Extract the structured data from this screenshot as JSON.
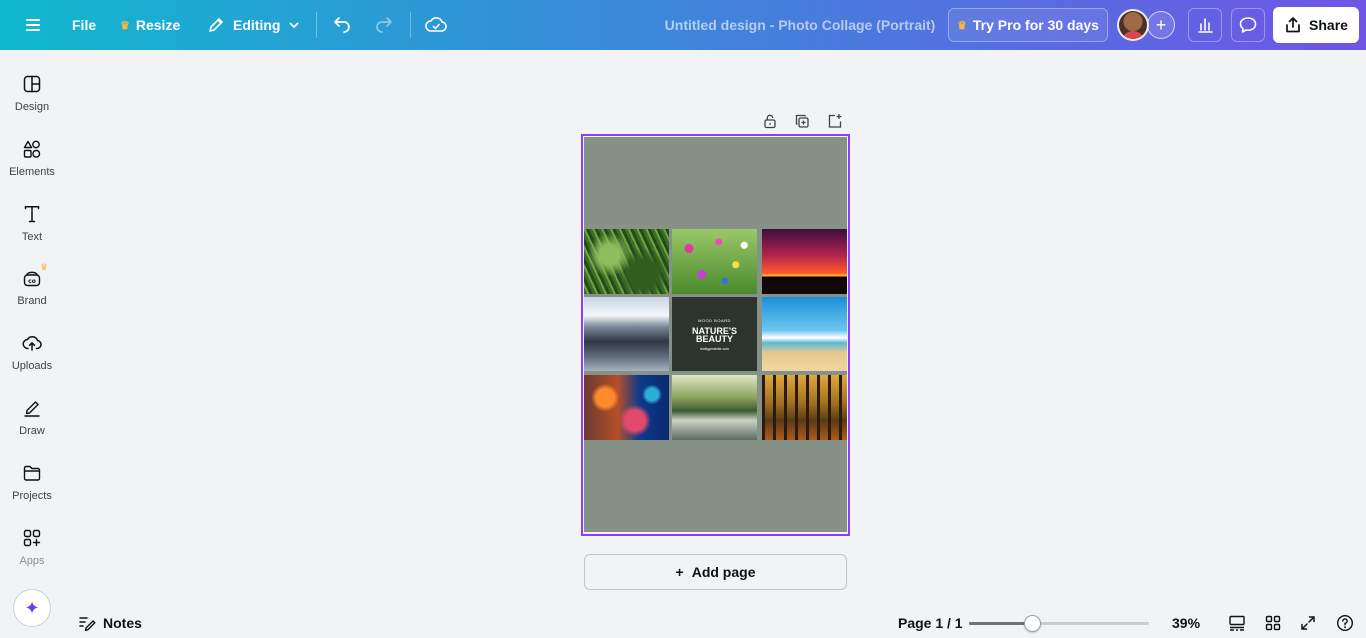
{
  "topbar": {
    "file_label": "File",
    "resize_label": "Resize",
    "editing_label": "Editing",
    "doc_title": "Untitled design - Photo Collage (Portrait)",
    "pro_label": "Try Pro for 30 days",
    "share_label": "Share"
  },
  "sidebar": {
    "items": [
      {
        "label": "Design",
        "icon": "design-icon"
      },
      {
        "label": "Elements",
        "icon": "elements-icon"
      },
      {
        "label": "Text",
        "icon": "text-icon"
      },
      {
        "label": "Brand",
        "icon": "brand-icon"
      },
      {
        "label": "Uploads",
        "icon": "uploads-icon"
      },
      {
        "label": "Draw",
        "icon": "draw-icon"
      },
      {
        "label": "Projects",
        "icon": "projects-icon"
      },
      {
        "label": "Apps",
        "icon": "apps-icon"
      }
    ]
  },
  "canvas": {
    "background_color": "#869188",
    "center_tile": {
      "small_text": "MOOD BOARD",
      "title_line1": "NATURE'S",
      "title_line2": "BEAUTY",
      "url_text": "reallygreatsite.com"
    },
    "add_page_label": "Add page"
  },
  "bottombar": {
    "notes_label": "Notes",
    "page_indicator": "Page 1 / 1",
    "zoom_percent": 39,
    "zoom_label": "39%"
  },
  "colors": {
    "accent": "#8b3dff",
    "gradient_start": "#10b8cf",
    "gradient_end": "#6f55e6"
  }
}
